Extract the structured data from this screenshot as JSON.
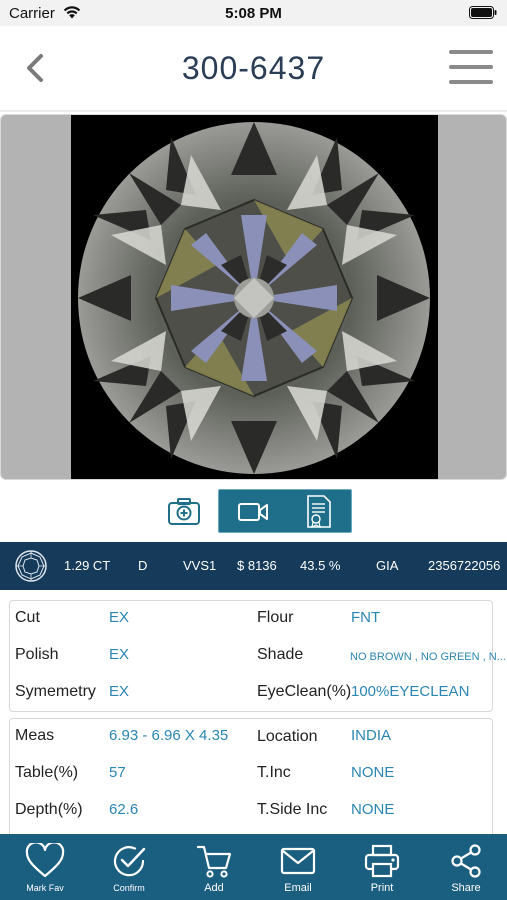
{
  "status_bar": {
    "carrier": "Carrier",
    "time": "5:08 PM"
  },
  "nav": {
    "title": "300-6437",
    "back_icon": "chevron-left-icon",
    "menu_icon": "hamburger-menu-icon"
  },
  "media": {
    "tabs": [
      {
        "name": "photo",
        "icon": "camera-icon"
      },
      {
        "name": "video",
        "icon": "video-camera-icon"
      },
      {
        "name": "certificate",
        "icon": "certificate-icon"
      }
    ],
    "active_tab_color": "#1f6f8b"
  },
  "summary": {
    "shape_icon": "round-diamond-icon",
    "carat": "1.29 CT",
    "color": "D",
    "clarity": "VVS1",
    "price": "$ 8136",
    "discount": "43.5 %",
    "lab": "GIA",
    "cert_no": "2356722056"
  },
  "details_primary": {
    "cut_label": "Cut",
    "cut_value": "EX",
    "flour_label": "Flour",
    "flour_value": "FNT",
    "polish_label": "Polish",
    "polish_value": "EX",
    "shade_label": "Shade",
    "shade_value": "NO BROWN , NO GREEN , N...",
    "symmetry_label": "Symemetry",
    "symmetry_value": "EX",
    "eyeclean_label": "EyeClean(%)",
    "eyeclean_value": "100%EYECLEAN"
  },
  "details_secondary": {
    "meas_label": "Meas",
    "meas_value": "6.93 - 6.96 X 4.35",
    "location_label": "Location",
    "location_value": "INDIA",
    "table_label": "Table(%)",
    "table_value": "57",
    "tinc_label": "T.Inc",
    "tinc_value": "NONE",
    "depth_label": "Depth(%)",
    "depth_value": "62.6",
    "tsideinc_label": "T.Side Inc",
    "tsideinc_value": "NONE"
  },
  "bottom_bar": {
    "items": [
      {
        "label": "Mark Fav",
        "icon": "heart-icon"
      },
      {
        "label": "Confirm",
        "icon": "check-circle-icon"
      },
      {
        "label": "Add",
        "icon": "cart-icon"
      },
      {
        "label": "Email",
        "icon": "envelope-icon"
      },
      {
        "label": "Print",
        "icon": "printer-icon"
      },
      {
        "label": "Share",
        "icon": "share-icon"
      }
    ]
  },
  "colors": {
    "title": "#2b3d55",
    "summary_bg": "#163a5a",
    "value_blue": "#2a86b3",
    "bottom_bar_bg": "#1a5e80"
  }
}
